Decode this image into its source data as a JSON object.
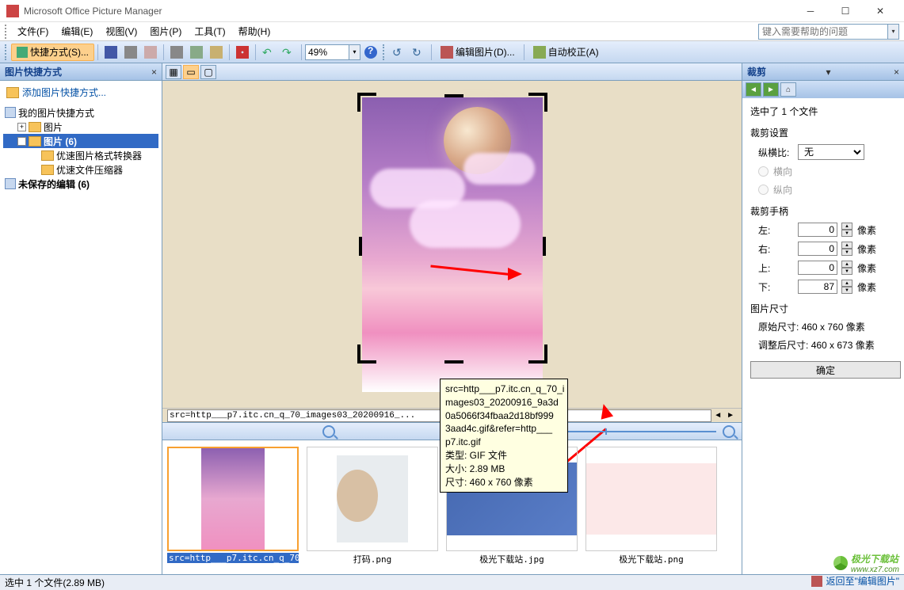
{
  "app": {
    "title": "Microsoft Office Picture Manager"
  },
  "menu": {
    "file": "文件(F)",
    "edit": "编辑(E)",
    "view": "视图(V)",
    "picture": "图片(P)",
    "tools": "工具(T)",
    "help": "帮助(H)",
    "help_placeholder": "键入需要帮助的问题"
  },
  "toolbar": {
    "shortcut_btn": "快捷方式(S)...",
    "zoom_value": "49%",
    "edit_pic": "编辑图片(D)...",
    "auto_correct": "自动校正(A)"
  },
  "left": {
    "title": "图片快捷方式",
    "add_link": "添加图片快捷方式...",
    "tree": {
      "root1": "我的图片快捷方式",
      "pictures1": "图片",
      "pictures2": "图片 (6)",
      "sub1": "优速图片格式转换器",
      "sub2": "优速文件压缩器",
      "unsaved": "未保存的编辑 (6)"
    }
  },
  "center": {
    "filename": "src=http___p7.itc.cn_q_70_images03_20200916_...",
    "thumbs": [
      {
        "label": "src=http___p7.itc.cn_q_70..."
      },
      {
        "label": "打码.png"
      },
      {
        "label": "极光下载站.jpg"
      },
      {
        "label": "极光下载站.png"
      }
    ]
  },
  "right": {
    "title": "裁剪",
    "selected": "选中了 1 个文件",
    "crop_settings": "裁剪设置",
    "aspect_label": "纵横比:",
    "aspect_value": "无",
    "landscape": "横向",
    "portrait": "纵向",
    "handles_title": "裁剪手柄",
    "left_l": "左:",
    "right_l": "右:",
    "top_l": "上:",
    "bottom_l": "下:",
    "left_v": "0",
    "right_v": "0",
    "top_v": "0",
    "bottom_v": "87",
    "px": "像素",
    "size_title": "图片尺寸",
    "orig_label": "原始尺寸:",
    "orig_val": "460 x 760 像素",
    "new_label": "调整后尺寸:",
    "new_val": "460 x 673 像素",
    "ok": "确定",
    "return": "返回至\"编辑图片\""
  },
  "tooltip": {
    "line1": "src=http___p7.itc.cn_q_70_i",
    "line2": "mages03_20200916_9a3d",
    "line3": "0a5066f34fbaa2d18bf999",
    "line4": "3aad4c.gif&refer=http___",
    "line5": "p7.itc.gif",
    "type": "类型: GIF 文件",
    "size": "大小: 2.89 MB",
    "dim": "尺寸: 460 x 760 像素"
  },
  "status": {
    "text": "选中 1 个文件(2.89 MB)"
  },
  "watermark": {
    "text": "极光下载站",
    "url": "www.xz7.com"
  }
}
